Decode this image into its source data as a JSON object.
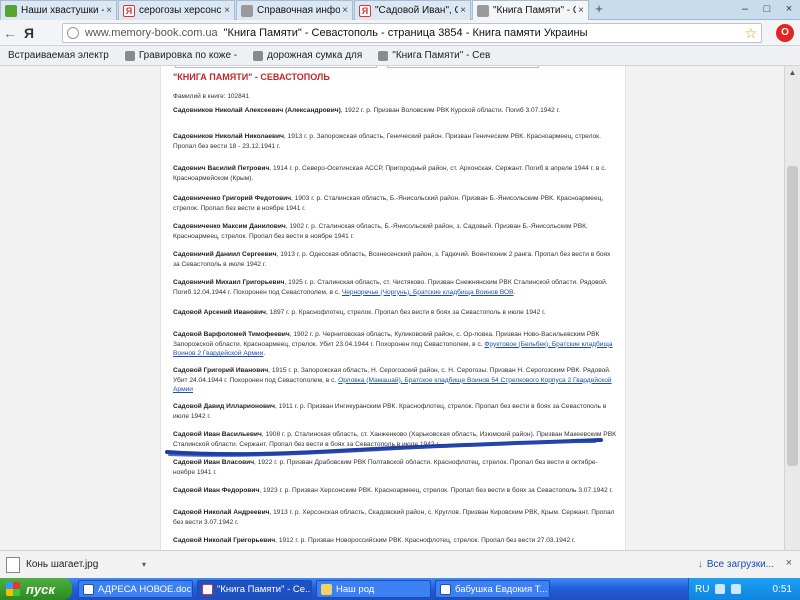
{
  "browser": {
    "tabs": [
      {
        "label": "Наши хвастушки - 2",
        "icon": "leaf-icon"
      },
      {
        "label": "серогозы херсонская о",
        "icon": "yandex-icon"
      },
      {
        "label": "Справочная информаци",
        "icon": "site-icon"
      },
      {
        "label": "\"Садовой Иван\", Садов",
        "icon": "yandex-icon"
      },
      {
        "label": "\"Книга Памяти\" - Севас",
        "icon": "site-icon",
        "active": true
      }
    ],
    "close_glyph": "×",
    "new_tab_glyph": "+",
    "window_controls": [
      "–",
      "□",
      "×"
    ],
    "back_glyph": "←",
    "yandex_logo": "Я",
    "address_domain": "www.memory-book.com.ua",
    "address_title": "\"Книга Памяти\" - Севастополь - страница 3854 - Книга памяти Украины",
    "bookmarks": [
      "Встраиваемая электр",
      "Гравировка по коже -",
      "дорожная сумка для",
      "\"Книга Памяти\" - Сев"
    ]
  },
  "page": {
    "book_title": "\"КНИГА ПАМЯТИ\" - СЕВАСТОПОЛЬ",
    "count_label": "Фамилий в книге:",
    "count_value": "102841",
    "entries": [
      {
        "name": "Садовников Николай Алексеевич (Александрович)",
        "text": ", 1922 г. р. Призван Воловским РВК Курской области. Погиб 3.07.1942 г.",
        "link": "",
        "tail": ""
      },
      {
        "name": "Садовников Николай Николаевич",
        "text": ", 1913 г. р. Запорожская область, Генический район. Призван Геническим РВК. Красноармеец, стрелок. Пропал без вести 18 - 23.12.1941 г.",
        "link": "",
        "tail": ""
      },
      {
        "name": "Садовнич Василий Петрович",
        "text": ", 1914 г. р. Северо-Осетинская АССР, Пригородный район, ст. Архонская. Сержант. Погиб в апреле 1944 г. в с. Красноармейском (Крым).",
        "link": "",
        "tail": ""
      },
      {
        "name": "Садовниченко Григорий Федотович",
        "text": ", 1903 г. р. Сталинская область, Б.-Янисольский район. Призван Б.-Янисольским РВК. Красноармеец, стрелок. Пропал без вести в ноябре 1941 г.",
        "link": "",
        "tail": ""
      },
      {
        "name": "Садовниченко Максим Данилович",
        "text": ", 1902 г. р. Сталинская область, Б.-Янисольский район, з. Садовый. Призван Б.-Янисольским РВК. Красноармеец, стрелок. Пропал без вести в ноябре 1941 г.",
        "link": "",
        "tail": ""
      },
      {
        "name": "Садовничий Даниил Сергеевич",
        "text": ", 1913 г. р. Одесская область, Вознесенский район, з. Гадючий. Воентехник 2 ранга. Пропал без вести в боях за Севастополь в июле 1942 г.",
        "link": "",
        "tail": ""
      },
      {
        "name": "Садовничий Михаил Григорьевич",
        "text": ", 1925 г. р. Сталинская область, ст. Чистяково. Призван Снежнянским РВК Сталинской области. Рядовой. Погиб 12.04.1944 г. Похоронен под Севастополем, в с. ",
        "link": "Черноречье (Чоргунь), Братские кладбища Воинов ВОВ",
        "tail": "."
      },
      {
        "name": "Садовой Арсений Иванович",
        "text": ", 1897 г. р. Краснофлотец, стрелок. Пропал без вести в боях за Севастополь в июле 1942 г.",
        "link": "",
        "tail": ""
      },
      {
        "name": "Садовой Варфоломей Тимофеевич",
        "text": ", 1902 г. р. Черниговская область, Куликовский район, с. Ор-ловка. Призван Ново-Васильевским РВК Запорожской области. Красноармеец, стрелок. Убит 23.04.1944 г. Похоронен под Севастополем, в с. ",
        "link": "Фруктовое (Бельбек), Братские кладбища Воинов 2 Гвардейской Армии",
        "tail": "."
      },
      {
        "name": "Садовой Григорий Иванович",
        "text": ", 1915 г. р. Запорожская область, Н. Серогозский район, с. Н. Серогозы. Призван Н. Серогозским РВК. Рядовой. Убит 24.04.1944 г. Похоронен под Севастополем, в с. ",
        "link": "Орловка (Мамашай), Братское кладбище Воинов 54 Стрелкового Корпуса 2 Гвардейской Армии",
        "tail": ""
      },
      {
        "name": "Садовой Давид Илларионович",
        "text": ", 1911 г. р. Призван Ингикуранским РВК. Краснофлотец, стрелок. Пропал без вести в боях за Севастополь в июле 1942 г.",
        "link": "",
        "tail": ""
      },
      {
        "name": "Садовой Иван Васильевич",
        "text": ", 1908 г. р. Сталинская область, ст. Ханженково (Харьковская область, Изюмский район). Призван Макеевским РВК Сталинской области. Сержант. Пропал без вести в боях за Севастополь в июле 1942 г.",
        "link": "",
        "tail": ""
      },
      {
        "name": "Садовой Иван Власович",
        "text": ", 1922 г. р. Призван Драбовским РВК Полтавской области. Краснофлотец, стрелок. Пропал без вести в октябре-ноябре 1941 г.",
        "link": "",
        "tail": ""
      },
      {
        "name": "Садовой Иван Федорович",
        "text": ", 1923 г. р. Призван Херсонским РВК. Красноармеец, стрелок. Пропал без вести в боях за Севастополь 3.07.1942 г.",
        "link": "",
        "tail": ""
      },
      {
        "name": "Садовой Николай Андреевич",
        "text": ", 1913 г. р. Херсонская область, Скадовский район, с. Круглов. Призван Кировским РВК, Крым. Сержант. Пропал без вести 3.07.1942 г.",
        "link": "",
        "tail": ""
      },
      {
        "name": "Садовой Николай Григорьевич",
        "text": ", 1912 г. р. Призван Новороссийским РВК. Краснофлотец, стрелок. Пропал без вести 27.03.1942 г.",
        "link": "",
        "tail": ""
      }
    ]
  },
  "downloads": {
    "file": "Конь шагает.jpg",
    "caret": "▾",
    "all_label": "Все загрузки...",
    "close_glyph": "×"
  },
  "taskbar": {
    "start_label": "пуск",
    "tasks": [
      {
        "label": "АДРЕСА НОВОЕ.doc ...",
        "icon": "word-icon"
      },
      {
        "label": "\"Книга Памяти\" - Се...",
        "icon": "yandex-icon",
        "active": true
      },
      {
        "label": "Наш род",
        "icon": "folder-icon"
      },
      {
        "label": "бабушка Евдокия Т...",
        "icon": "word-icon"
      }
    ],
    "lang": "RU",
    "clock": "0:51"
  },
  "colors": {
    "book_title": "#c0282a",
    "link": "#1a4fb0",
    "annotation_stroke": "#1f3fa0",
    "taskbar": "#245edb",
    "start_button": "#379a2a"
  }
}
